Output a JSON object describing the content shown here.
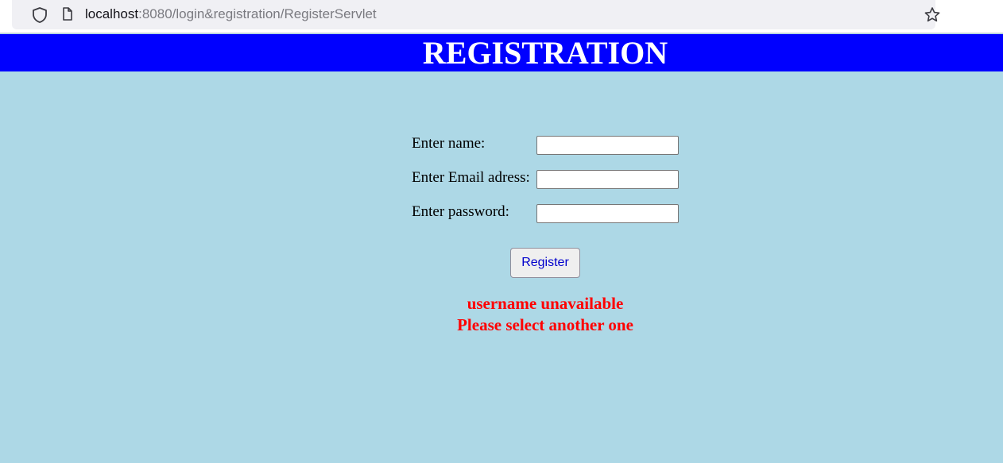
{
  "browser": {
    "url_host": "localhost",
    "url_path": ":8080/login&registration/RegisterServlet"
  },
  "header": {
    "title": "REGISTRATION",
    "background": "#0000ff"
  },
  "page": {
    "background": "#add8e6"
  },
  "form": {
    "name_label": "Enter name:",
    "name_value": "",
    "email_label": "Enter Email adress:",
    "email_value": "",
    "password_label": "Enter password:",
    "password_value": "",
    "submit_label": "Register"
  },
  "error": {
    "line1": "username unavailable",
    "line2": "Please select another one",
    "color": "#ff0000"
  }
}
